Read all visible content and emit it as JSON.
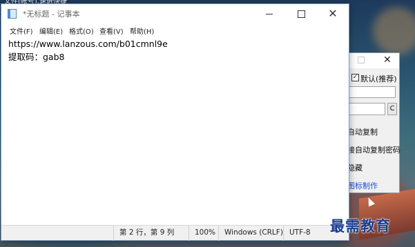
{
  "desktop": {
    "top_text": "文件(帐号),速进快捷"
  },
  "background_window": {
    "close_glyph": "✕",
    "checkbox_label": "默认(推荐)",
    "c_button": "C",
    "options": [
      "自动复制",
      "接自动复制密码",
      "隐藏",
      "图标制作"
    ]
  },
  "notepad": {
    "title": "*无标题 - 记事本",
    "menus": [
      "文件(F)",
      "编辑(E)",
      "格式(O)",
      "查看(V)",
      "帮助(H)"
    ],
    "lines": [
      "https://www.lanzous.com/b01cmnl9e",
      "提取码：gab8"
    ],
    "status": {
      "position": "第 2 行，第 9 列",
      "zoom": "100%",
      "line_ending": "Windows (CRLF)",
      "encoding": "UTF-8"
    },
    "controls": {
      "close_glyph": "✕"
    }
  },
  "watermark": "最需教育",
  "colors": {
    "accent": "#1a4fd0",
    "watermark": "#1b3d8f"
  }
}
